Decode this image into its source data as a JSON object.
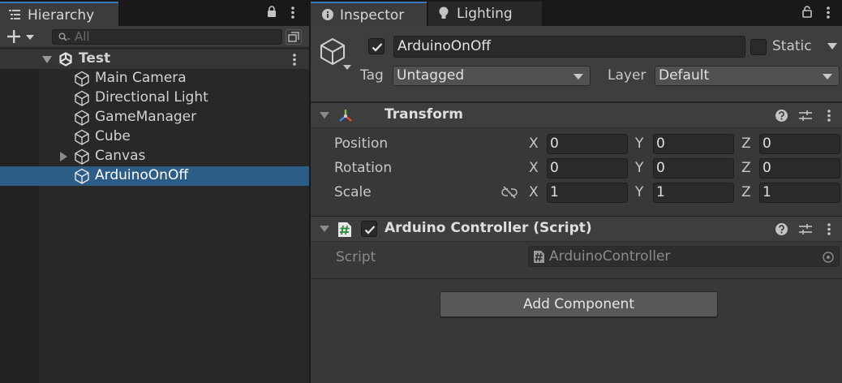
{
  "hierarchy": {
    "tab_label": "Hierarchy",
    "search_placeholder": "All",
    "scene_name": "Test",
    "items": [
      {
        "label": "Main Camera"
      },
      {
        "label": "Directional Light"
      },
      {
        "label": "GameManager"
      },
      {
        "label": "Cube"
      },
      {
        "label": "Canvas"
      },
      {
        "label": "ArduinoOnOff"
      }
    ],
    "selected_item": "ArduinoOnOff"
  },
  "inspector": {
    "tabs": [
      {
        "label": "Inspector"
      },
      {
        "label": "Lighting"
      }
    ],
    "object_name": "ArduinoOnOff",
    "static_label": "Static",
    "tag_label": "Tag",
    "tag_value": "Untagged",
    "layer_label": "Layer",
    "layer_value": "Default",
    "transform": {
      "title": "Transform",
      "rows": [
        {
          "label": "Position",
          "x": "0",
          "y": "0",
          "z": "0"
        },
        {
          "label": "Rotation",
          "x": "0",
          "y": "0",
          "z": "0"
        },
        {
          "label": "Scale",
          "x": "1",
          "y": "1",
          "z": "1"
        }
      ],
      "axes": {
        "x": "X",
        "y": "Y",
        "z": "Z"
      }
    },
    "script_component": {
      "title": "Arduino Controller (Script)",
      "field_label": "Script",
      "field_value": "ArduinoController"
    },
    "add_component_label": "Add Component"
  },
  "colors": {
    "accent": "#3a79bb",
    "selection": "#2c5d87",
    "panel": "#383838"
  }
}
